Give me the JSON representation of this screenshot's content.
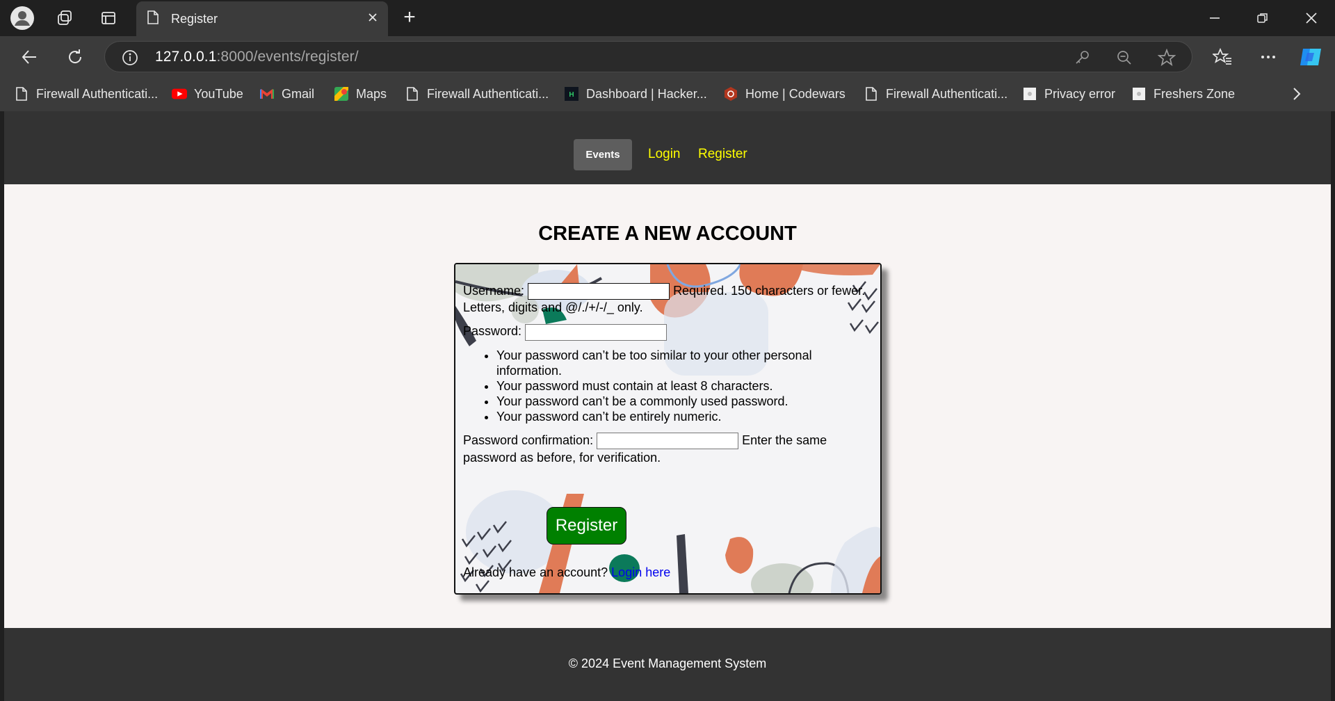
{
  "browser": {
    "tab": {
      "title": "Register"
    },
    "new_tab_symbol": "+",
    "url_host": "127.0.0.1",
    "url_rest": ":8000/events/register/",
    "bookmarks": [
      {
        "label": "Firewall Authenticati...",
        "icon": "page-icon"
      },
      {
        "label": "YouTube",
        "icon": "youtube-icon"
      },
      {
        "label": "Gmail",
        "icon": "gmail-icon"
      },
      {
        "label": "Maps",
        "icon": "maps-icon"
      },
      {
        "label": "Firewall Authenticati...",
        "icon": "page-icon"
      },
      {
        "label": "Dashboard | Hacker...",
        "icon": "hackerrank-icon"
      },
      {
        "label": "Home | Codewars",
        "icon": "codewars-icon"
      },
      {
        "label": "Firewall Authenticati...",
        "icon": "page-icon"
      },
      {
        "label": "Privacy error",
        "icon": "privacy-icon"
      },
      {
        "label": "Freshers Zone",
        "icon": "freshers-icon"
      }
    ]
  },
  "nav": {
    "events": "Events",
    "login": "Login",
    "register": "Register"
  },
  "page": {
    "title": "CREATE A NEW ACCOUNT"
  },
  "form": {
    "username_label": "Username:",
    "username_value": "",
    "username_help": "Required. 150 characters or fewer. Letters, digits and @/./+/-/_ only.",
    "password_label": "Password:",
    "password_value": "",
    "password_rules": [
      "Your password can’t be too similar to your other personal information.",
      "Your password must contain at least 8 characters.",
      "Your password can’t be a commonly used password.",
      "Your password can’t be entirely numeric."
    ],
    "confirm_label": "Password confirmation:",
    "confirm_value": "",
    "confirm_help": "Enter the same password as before, for verification.",
    "submit_label": "Register",
    "login_prompt": "Already have an account?",
    "login_link": "Login here"
  },
  "footer": {
    "text": "© 2024 Event Management System"
  },
  "colors": {
    "nav_link": "#ffff00",
    "register_button": "#008000",
    "login_link": "#0000ee",
    "deco_orange": "#e07b57",
    "deco_green": "#0b7a5a"
  }
}
